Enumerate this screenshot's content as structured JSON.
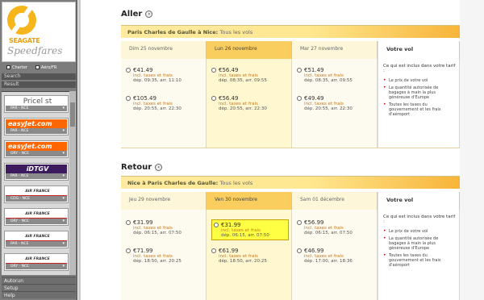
{
  "sidebar": {
    "brand": "SEAGATE",
    "app_name": "Speedfares",
    "checkbox1": "Charter",
    "checkbox2": "Aéro/FR",
    "nav1": "Search",
    "nav2": "Result",
    "providers": [
      {
        "name": "Pricel st",
        "sub": "PAR - NCE",
        "style": "price"
      },
      {
        "name": "easyJet.com",
        "sub": "PAR - NCE",
        "style": "easy"
      },
      {
        "name": "easyJet.com",
        "sub": "ORY - NCE",
        "style": "easy"
      },
      {
        "name": "iDTGV",
        "sub": "PAR - NCE",
        "style": "idtgv"
      },
      {
        "name": "AIR FRANCE",
        "sub": "CDG - NCE",
        "style": "af"
      },
      {
        "name": "AIR FRANCE",
        "sub": "ORY - NCE",
        "style": "af"
      },
      {
        "name": "AIR FRANCE",
        "sub": "PAR - NCE",
        "style": "af"
      },
      {
        "name": "AIR FRANCE",
        "sub": "ORY - NCE",
        "style": "af"
      }
    ],
    "bottom": [
      "Autorun",
      "Setup",
      "Help"
    ]
  },
  "aller": {
    "title": "Aller",
    "route": "Paris Charles de Gaulle à Nice:",
    "route_extra": "Tous les vols",
    "cols": [
      "Dim 25 novembre",
      "Lun 26 novembre",
      "Mar 27 novembre",
      "Votre vol"
    ],
    "fares": [
      [
        {
          "price": "€41.49",
          "tax": "incl. taxes et frais",
          "time": "dép. 09:35, arr. 11:10"
        },
        {
          "price": "€105.49",
          "tax": "incl. taxes et frais",
          "time": "dép. 20:55, arr. 22:30"
        }
      ],
      [
        {
          "price": "€56.49",
          "tax": "incl. taxes et frais",
          "time": "dép. 08:35, arr. 09:55"
        },
        {
          "price": "€56.49",
          "tax": "incl. taxes et frais",
          "time": "dép. 20:55, arr. 22:30"
        }
      ],
      [
        {
          "price": "€51.49",
          "tax": "incl. taxes et frais",
          "time": "dép. 08:35, arr. 09:55"
        },
        {
          "price": "€49.49",
          "tax": "incl. taxes et frais",
          "time": "dép. 20:55, arr. 22:30"
        }
      ]
    ],
    "info_title": "Ce qui est inclus dans votre tarif :",
    "info_items": [
      "Le prix de votre vol",
      "La quantité autorisée de bagages à main la plus généreuse d'Europe",
      "Toutes les taxes du gouvernement et les frais d'aéroport"
    ]
  },
  "retour": {
    "title": "Retour",
    "route": "Nice à Paris Charles de Gaulle:",
    "route_extra": "Tous les vols",
    "cols": [
      "Jeu 29 novembre",
      "Ven 30 novembre",
      "Sam 01 décembre",
      "Votre vol"
    ],
    "fares": [
      [
        {
          "price": "€31.99",
          "tax": "incl. taxes et frais",
          "time": "dép. 06:15, arr. 07:50"
        },
        {
          "price": "€71.99",
          "tax": "incl. taxes et frais",
          "time": "dép. 18:50, arr. 20:25"
        }
      ],
      [
        {
          "price": "€31.99",
          "tax": "incl. taxes et frais",
          "time": "dép. 06:15, arr. 07:50",
          "selected": true
        },
        {
          "price": "€61.99",
          "tax": "incl. taxes et frais",
          "time": "dép. 18:50, arr. 20:25"
        }
      ],
      [
        {
          "price": "€56.99",
          "tax": "incl. taxes et frais",
          "time": "dép. 06:15, arr. 07:50"
        },
        {
          "price": "€46.99",
          "tax": "incl. taxes et frais",
          "time": "dép. 17:00, arr. 18:36"
        }
      ]
    ],
    "info_title": "Ce qui est inclus dans votre tarif :",
    "info_items": [
      "Le prix de votre vol",
      "La quantité autorisée de bagages à main la plus généreuse d'Europe",
      "Toutes les taxes du gouvernement et les frais d'aéroport"
    ]
  }
}
